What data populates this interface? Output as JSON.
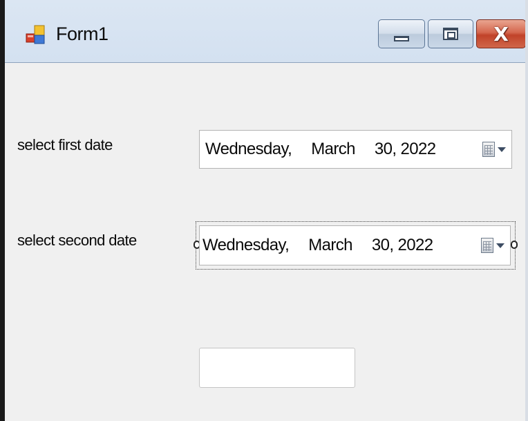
{
  "window": {
    "title": "Form1",
    "icons": {
      "app": "form-app-icon",
      "minimize": "minimize-icon",
      "maximize": "maximize-icon",
      "close": "close-icon"
    },
    "close_glyph": "X"
  },
  "form": {
    "first_date_label": "select first date",
    "second_date_label": "select second date",
    "first_date": {
      "day_of_week": "Wednesday,",
      "month": "March",
      "day_year": "30, 2022"
    },
    "second_date": {
      "day_of_week": "Wednesday,",
      "month": "March",
      "day_year": "30, 2022"
    },
    "result_textbox": {
      "value": ""
    }
  },
  "colors": {
    "title_bar": "#c7d8ec",
    "client_background": "#f0f0f0",
    "close_button": "#c1432a"
  }
}
